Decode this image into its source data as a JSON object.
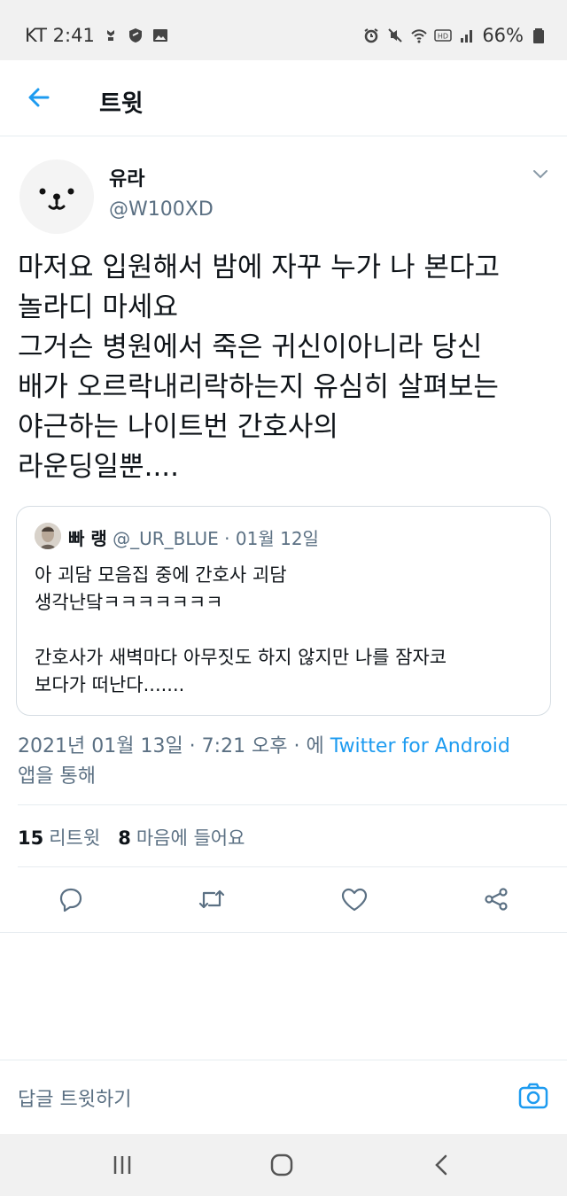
{
  "status_bar": {
    "carrier_time": "KT 2:41",
    "battery": "66%",
    "icons": [
      "notification-icon",
      "shield-icon",
      "image-icon",
      "alarm-icon",
      "mute-icon",
      "wifi-icon",
      "hd-icon",
      "signal-icon",
      "battery-icon"
    ]
  },
  "header": {
    "title": "트윗",
    "back_icon": "arrow-left-icon"
  },
  "tweet": {
    "display_name": "유라",
    "handle": "@W100XD",
    "text": "마저요 입원해서 밤에 자꾸 누가 나 본다고\n놀라디 마세요\n그거슨 병원에서 죽은 귀신이아니라 당신\n배가 오르락내리락하는지 유심히 살펴보는\n야근하는 나이트번 간호사의\n라운딩일뿐....",
    "quote": {
      "name": "빠 랭",
      "handle": "@_UR_BLUE",
      "separator": "·",
      "date": "01월 12일",
      "text": "아 괴담 모음집 중에 간호사 괴담\n생각난닼ㅋㅋㅋㅋㅋㅋㅋ\n\n간호사가 새벽마다 아무짓도 하지 않지만 나를 잠자코\n보다가 떠난다......."
    },
    "timestamp_prefix": "2021년 01월 13일 · 7:21 오후 · 에 ",
    "source": "Twitter for Android",
    "timestamp_suffix": "앱을 통해",
    "retweets_count": "15",
    "retweets_label": "리트윗",
    "likes_count": "8",
    "likes_label": "마음에 들어요"
  },
  "actions": [
    "reply-icon",
    "retweet-icon",
    "like-icon",
    "share-icon"
  ],
  "reply_bar": {
    "placeholder": "답글 트윗하기"
  },
  "colors": {
    "accent": "#1d9bf0",
    "text": "#0f1419",
    "secondary": "#5b7083",
    "border": "#e6ecf0"
  }
}
